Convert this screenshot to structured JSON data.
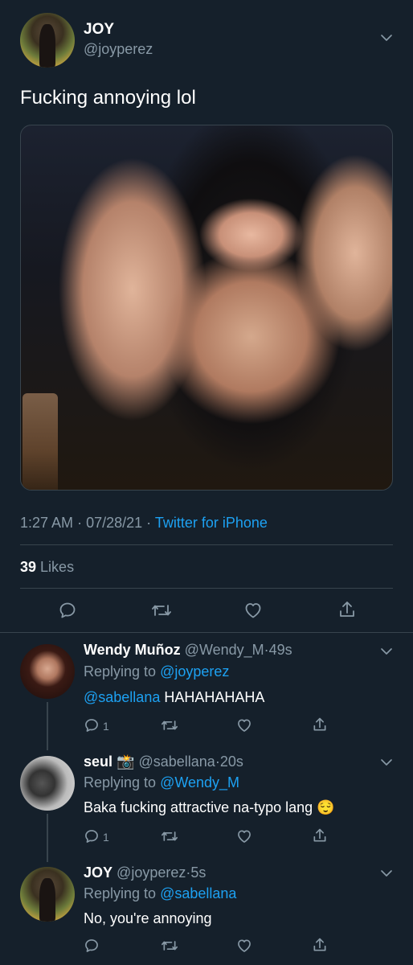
{
  "main_tweet": {
    "name": "JOY",
    "handle": "@joyperez",
    "text": "Fucking annoying lol",
    "time": "1:27 AM",
    "dot1": "·",
    "date": "07/28/21",
    "dot2": "·",
    "source": "Twitter for iPhone",
    "likes_count": "39",
    "likes_label": "Likes",
    "photo_icon": "photo-of-woman"
  },
  "replies": [
    {
      "name": "Wendy Muñoz",
      "handle": "@Wendy_M",
      "dot": "·",
      "time": "49s",
      "replying_label": "Replying to",
      "replying_to": "@joyperez",
      "mention": "@sabellana",
      "text": " HAHAHAHAHA",
      "reply_count": "1"
    },
    {
      "name": "seul",
      "emoji": "📸",
      "handle": "@sabellana",
      "dot": "·",
      "time": "20s",
      "replying_label": "Replying to",
      "replying_to": "@Wendy_M",
      "text": "Baka fucking attractive na-typo lang",
      "text_emoji": "😌",
      "reply_count": "1"
    },
    {
      "name": "JOY",
      "handle": "@joyperez",
      "dot": "·",
      "time": "5s",
      "replying_label": "Replying to",
      "replying_to": "@sabellana",
      "text": "No, you're annoying",
      "reply_count": ""
    }
  ],
  "icons": {
    "reply": "reply-icon",
    "retweet": "retweet-icon",
    "like": "heart-icon",
    "share": "share-icon",
    "more": "chevron-down-icon"
  },
  "colors": {
    "background": "#15202b",
    "accent": "#1da1f2",
    "secondary_text": "#8899a6",
    "divider": "#38444d"
  }
}
